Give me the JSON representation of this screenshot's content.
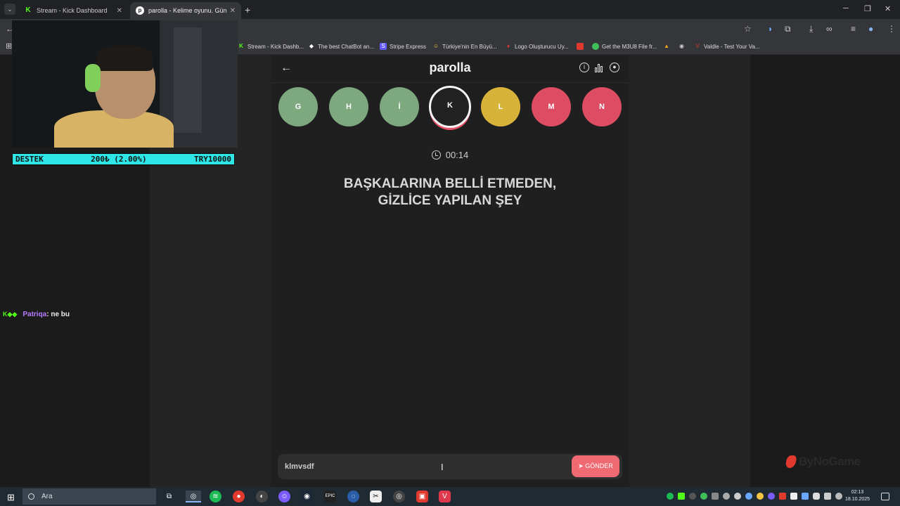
{
  "browser": {
    "tabs": [
      {
        "title": "Stream - Kick Dashboard",
        "favicon": "kick-icon"
      },
      {
        "title": "parolla - Kelime oyunu. Günlük",
        "favicon": "parolla-icon"
      }
    ],
    "bookmarks": [
      "Stream - Kick Dashb...",
      "The best ChatBot an...",
      "Stripe Express",
      "Türkiye'nin En Büyü...",
      "Logo Oluşturucu Uy...",
      "Get the M3U8 File fr...",
      "Valdle - Test Your Va..."
    ]
  },
  "app": {
    "title": "parolla",
    "letters": [
      {
        "letter": "G",
        "state": "correct"
      },
      {
        "letter": "H",
        "state": "correct"
      },
      {
        "letter": "İ",
        "state": "correct"
      },
      {
        "letter": "K",
        "state": "active"
      },
      {
        "letter": "L",
        "state": "passed"
      },
      {
        "letter": "M",
        "state": "wrong"
      },
      {
        "letter": "N",
        "state": "wrong"
      }
    ],
    "timer": "00:14",
    "question_line1": "BAŞKALARINA BELLİ ETMEDEN,",
    "question_line2": "GİZLİCE YAPILAN ŞEY",
    "answer_value": "klmvsdf",
    "send_label": "GÖNDER"
  },
  "stream_overlay": {
    "goal_label": "DESTEK",
    "goal_amount": "200₺ (2.00%)",
    "goal_target": "TRY10000",
    "chat_user": "Patriqa",
    "chat_message": ": ne bu",
    "brand": "ByNoGame"
  },
  "taskbar": {
    "search_placeholder": "Ara",
    "time": "02:13",
    "date": "18.10.2025"
  },
  "colors": {
    "correct": "#7ea97f",
    "passed": "#d8b33a",
    "wrong": "#de4c63",
    "send": "#f06a73",
    "goal_bar": "#2ee6e6"
  }
}
